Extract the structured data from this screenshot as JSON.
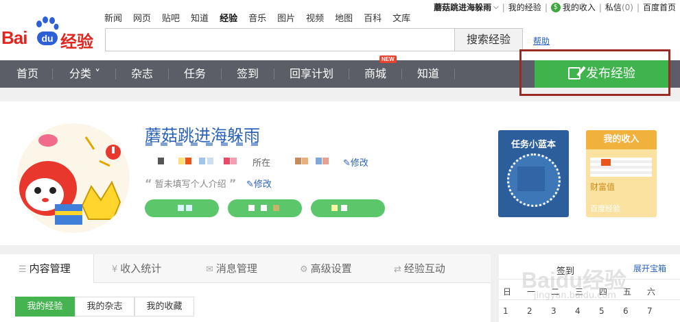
{
  "logo": {
    "bai": "Bai",
    "du": "du",
    "jingyan": "经验"
  },
  "top_nav": [
    "新闻",
    "网页",
    "贴吧",
    "知道",
    "经验",
    "音乐",
    "图片",
    "视频",
    "地图",
    "百科",
    "文库"
  ],
  "user_bar": {
    "username": "蘑菇跳进海躲雨",
    "my_experience": "我的经验",
    "my_income": "我的收入",
    "messages": "私信",
    "message_count": "(0)",
    "baidu_home": "百度首页"
  },
  "search": {
    "placeholder": "",
    "button": "搜索经验",
    "help": "帮助"
  },
  "main_nav": [
    {
      "label": "首页"
    },
    {
      "label": "分类 ˅"
    },
    {
      "label": "杂志"
    },
    {
      "label": "任务"
    },
    {
      "label": "签到"
    },
    {
      "label": "回享计划"
    },
    {
      "label": "商城"
    },
    {
      "label": "知道"
    }
  ],
  "new_badge": "NEW",
  "publish_button": "发布经验",
  "profile": {
    "name": "蘑菇跳进海躲雨",
    "info_partial": "所在",
    "edit_label": "修改",
    "intro": "暂未填写个人介绍",
    "intro_edit": "修改"
  },
  "cards": {
    "task_title": "任务小蓝本",
    "income_title": "我的收入",
    "wealth_label": "财富值",
    "baidu_jingyan": "百度经验"
  },
  "tabs": [
    "内容管理",
    "收入统计",
    "消息管理",
    "高级设置",
    "经验互动"
  ],
  "sub_tabs": [
    "我的经验",
    "我的杂志",
    "我的收藏"
  ],
  "calendar": {
    "title": "签到",
    "expand": "展开宝箱",
    "weekdays": [
      "日",
      "一",
      "二",
      "三",
      "四",
      "五",
      "六"
    ],
    "days": [
      "1",
      "2",
      "3",
      "4",
      "5",
      "6",
      "7"
    ]
  },
  "watermark": {
    "logo": "Baidu经验",
    "url": "jingyan.baidu.com"
  },
  "colors": {
    "green": "#3fb44c",
    "nav_bg": "#5b5e66",
    "link_blue": "#2c62b8",
    "brand_red": "#e0261f"
  }
}
